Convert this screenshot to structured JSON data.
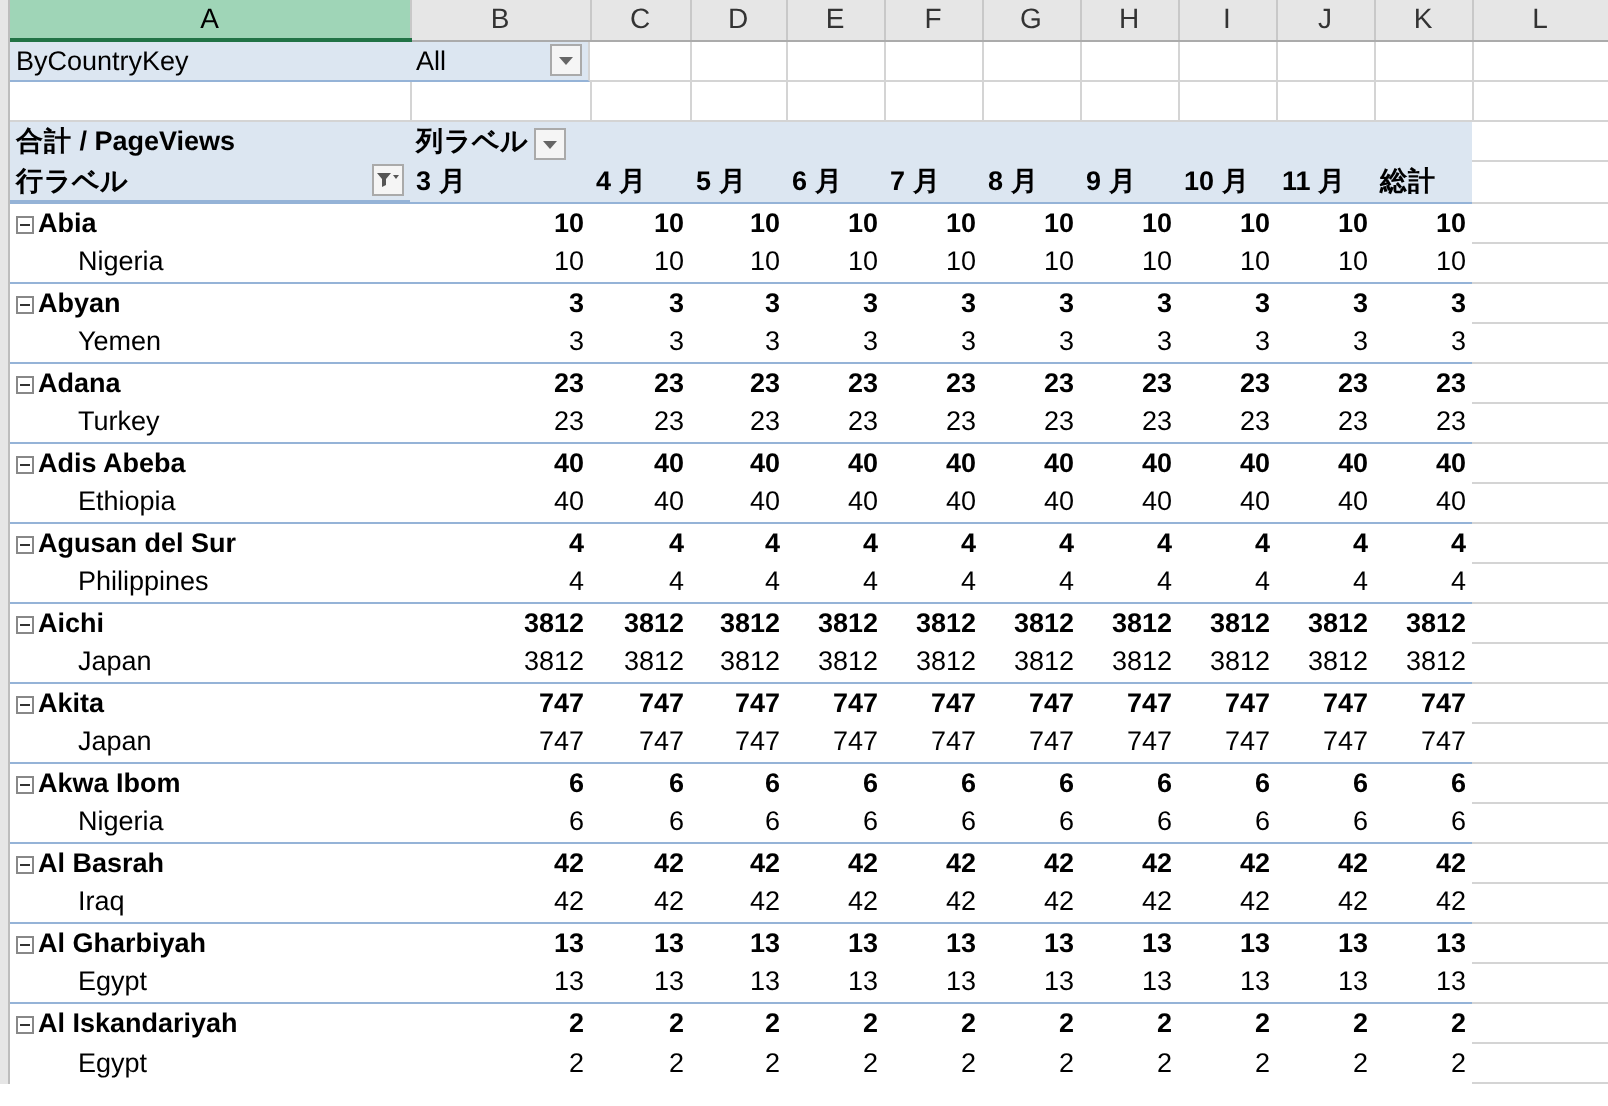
{
  "columns": [
    {
      "label": "A",
      "selected": true
    },
    {
      "label": "B",
      "selected": false
    },
    {
      "label": "C",
      "selected": false
    },
    {
      "label": "D",
      "selected": false
    },
    {
      "label": "E",
      "selected": false
    },
    {
      "label": "F",
      "selected": false
    },
    {
      "label": "G",
      "selected": false
    },
    {
      "label": "H",
      "selected": false
    },
    {
      "label": "I",
      "selected": false
    },
    {
      "label": "J",
      "selected": false
    },
    {
      "label": "K",
      "selected": false
    },
    {
      "label": "L",
      "selected": false
    }
  ],
  "filter": {
    "label": "ByCountryKey",
    "value": "All"
  },
  "pivot_header": {
    "value_label": "合計 / PageViews",
    "column_label": "列ラベル",
    "row_label": "行ラベル",
    "row_filter_applied": true,
    "columns": [
      "3 月",
      "4 月",
      "5 月",
      "6 月",
      "7 月",
      "8 月",
      "9 月",
      "10 月",
      "11 月",
      "総計"
    ]
  },
  "rows": [
    {
      "kind": "region",
      "label": "Abia",
      "expanded": true,
      "values": [
        "10",
        "10",
        "10",
        "10",
        "10",
        "10",
        "10",
        "10",
        "10",
        "10"
      ]
    },
    {
      "kind": "country",
      "label": "Nigeria",
      "values": [
        "10",
        "10",
        "10",
        "10",
        "10",
        "10",
        "10",
        "10",
        "10",
        "10"
      ]
    },
    {
      "kind": "region",
      "label": "Abyan",
      "expanded": true,
      "values": [
        "3",
        "3",
        "3",
        "3",
        "3",
        "3",
        "3",
        "3",
        "3",
        "3"
      ]
    },
    {
      "kind": "country",
      "label": "Yemen",
      "values": [
        "3",
        "3",
        "3",
        "3",
        "3",
        "3",
        "3",
        "3",
        "3",
        "3"
      ]
    },
    {
      "kind": "region",
      "label": "Adana",
      "expanded": true,
      "values": [
        "23",
        "23",
        "23",
        "23",
        "23",
        "23",
        "23",
        "23",
        "23",
        "23"
      ]
    },
    {
      "kind": "country",
      "label": "Turkey",
      "values": [
        "23",
        "23",
        "23",
        "23",
        "23",
        "23",
        "23",
        "23",
        "23",
        "23"
      ]
    },
    {
      "kind": "region",
      "label": "Adis Abeba",
      "expanded": true,
      "values": [
        "40",
        "40",
        "40",
        "40",
        "40",
        "40",
        "40",
        "40",
        "40",
        "40"
      ]
    },
    {
      "kind": "country",
      "label": "Ethiopia",
      "values": [
        "40",
        "40",
        "40",
        "40",
        "40",
        "40",
        "40",
        "40",
        "40",
        "40"
      ]
    },
    {
      "kind": "region",
      "label": "Agusan del Sur",
      "expanded": true,
      "values": [
        "4",
        "4",
        "4",
        "4",
        "4",
        "4",
        "4",
        "4",
        "4",
        "4"
      ]
    },
    {
      "kind": "country",
      "label": "Philippines",
      "values": [
        "4",
        "4",
        "4",
        "4",
        "4",
        "4",
        "4",
        "4",
        "4",
        "4"
      ]
    },
    {
      "kind": "region",
      "label": "Aichi",
      "expanded": true,
      "values": [
        "3812",
        "3812",
        "3812",
        "3812",
        "3812",
        "3812",
        "3812",
        "3812",
        "3812",
        "3812"
      ]
    },
    {
      "kind": "country",
      "label": "Japan",
      "values": [
        "3812",
        "3812",
        "3812",
        "3812",
        "3812",
        "3812",
        "3812",
        "3812",
        "3812",
        "3812"
      ]
    },
    {
      "kind": "region",
      "label": "Akita",
      "expanded": true,
      "values": [
        "747",
        "747",
        "747",
        "747",
        "747",
        "747",
        "747",
        "747",
        "747",
        "747"
      ]
    },
    {
      "kind": "country",
      "label": "Japan",
      "values": [
        "747",
        "747",
        "747",
        "747",
        "747",
        "747",
        "747",
        "747",
        "747",
        "747"
      ]
    },
    {
      "kind": "region",
      "label": "Akwa Ibom",
      "expanded": true,
      "values": [
        "6",
        "6",
        "6",
        "6",
        "6",
        "6",
        "6",
        "6",
        "6",
        "6"
      ]
    },
    {
      "kind": "country",
      "label": "Nigeria",
      "values": [
        "6",
        "6",
        "6",
        "6",
        "6",
        "6",
        "6",
        "6",
        "6",
        "6"
      ]
    },
    {
      "kind": "region",
      "label": "Al Basrah",
      "expanded": true,
      "values": [
        "42",
        "42",
        "42",
        "42",
        "42",
        "42",
        "42",
        "42",
        "42",
        "42"
      ]
    },
    {
      "kind": "country",
      "label": "Iraq",
      "values": [
        "42",
        "42",
        "42",
        "42",
        "42",
        "42",
        "42",
        "42",
        "42",
        "42"
      ]
    },
    {
      "kind": "region",
      "label": "Al Gharbiyah",
      "expanded": true,
      "values": [
        "13",
        "13",
        "13",
        "13",
        "13",
        "13",
        "13",
        "13",
        "13",
        "13"
      ]
    },
    {
      "kind": "country",
      "label": "Egypt",
      "values": [
        "13",
        "13",
        "13",
        "13",
        "13",
        "13",
        "13",
        "13",
        "13",
        "13"
      ]
    },
    {
      "kind": "region",
      "label": "Al Iskandariyah",
      "expanded": true,
      "values": [
        "2",
        "2",
        "2",
        "2",
        "2",
        "2",
        "2",
        "2",
        "2",
        "2"
      ]
    },
    {
      "kind": "country",
      "label": "Egypt",
      "values": [
        "2",
        "2",
        "2",
        "2",
        "2",
        "2",
        "2",
        "2",
        "2",
        "2"
      ]
    }
  ]
}
